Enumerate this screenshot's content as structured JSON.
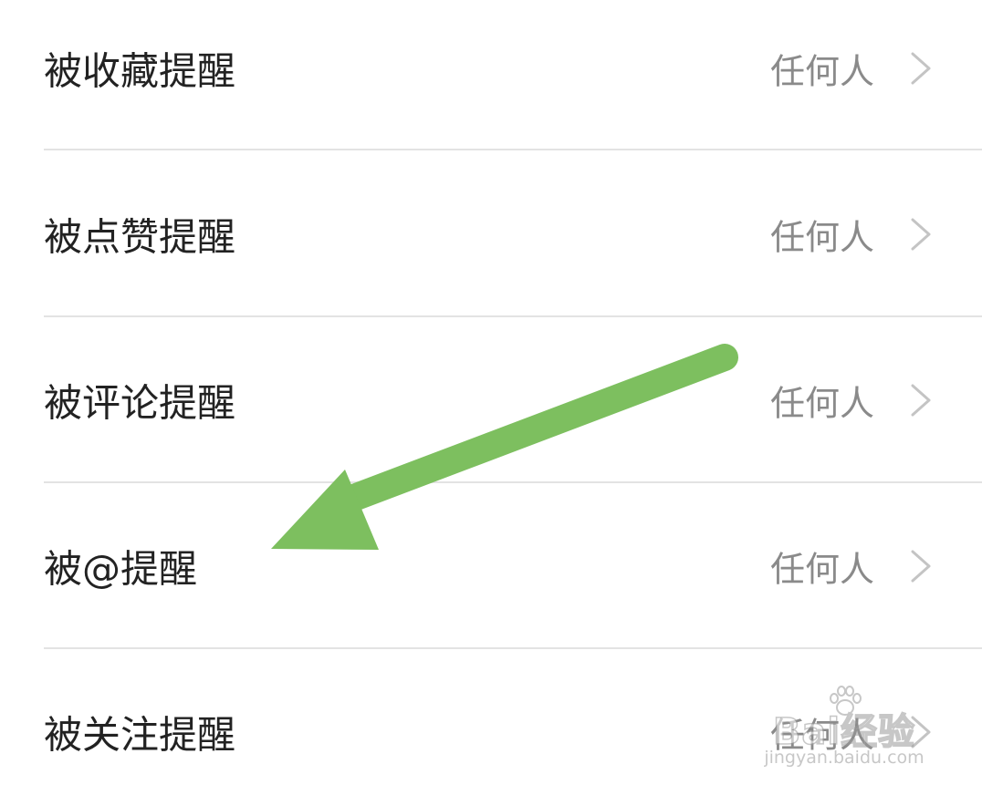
{
  "settings": {
    "rows": [
      {
        "label": "被收藏提醒",
        "value": "任何人"
      },
      {
        "label": "被点赞提醒",
        "value": "任何人"
      },
      {
        "label": "被评论提醒",
        "value": "任何人"
      },
      {
        "label": "被@提醒",
        "value": "任何人"
      },
      {
        "label": "被关注提醒",
        "value": "任何人"
      }
    ]
  },
  "annotation": {
    "arrow_color": "#7dbf5f",
    "points_to": "被@提醒"
  },
  "watermark": {
    "brand": "Bai经验",
    "url": "jingyan.baidu.com"
  },
  "colors": {
    "label_text": "#222222",
    "value_text": "#8a8a8a",
    "chevron": "#c4c4c4",
    "divider": "#e3e3e3"
  }
}
